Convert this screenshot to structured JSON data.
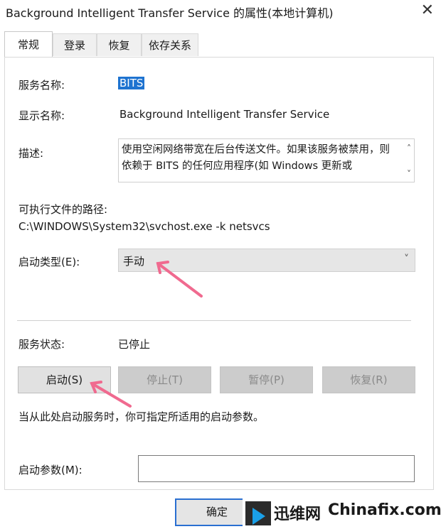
{
  "window": {
    "title": "Background Intelligent Transfer Service 的属性(本地计算机)",
    "close_symbol": "✕"
  },
  "tabs": [
    {
      "label": "常规",
      "active": true
    },
    {
      "label": "登录",
      "active": false
    },
    {
      "label": "恢复",
      "active": false
    },
    {
      "label": "依存关系",
      "active": false
    }
  ],
  "general": {
    "service_name_label": "服务名称:",
    "service_name": "BITS",
    "display_name_label": "显示名称:",
    "display_name": "Background Intelligent Transfer Service",
    "description_label": "描述:",
    "description": "使用空闲网络带宽在后台传送文件。如果该服务被禁用，则依赖于 BITS 的任何应用程序(如 Windows 更新或",
    "path_label": "可执行文件的路径:",
    "path": "C:\\WINDOWS\\System32\\svchost.exe -k netsvcs",
    "startup_type_label": "启动类型(E):",
    "startup_type": "手动",
    "status_label": "服务状态:",
    "status": "已停止",
    "buttons": {
      "start": "启动(S)",
      "stop": "停止(T)",
      "pause": "暂停(P)",
      "resume": "恢复(R)"
    },
    "hint": "当从此处启动服务时，你可指定所适用的启动参数。",
    "params_label": "启动参数(M):",
    "params_value": ""
  },
  "footer": {
    "ok": "确定"
  },
  "watermark": {
    "cn": "迅维网",
    "en": "Chinafix.com"
  },
  "colors": {
    "selection": "#1e73d0",
    "annotation_arrow": "#f06a8f",
    "ok_border": "#2a6fd1"
  }
}
